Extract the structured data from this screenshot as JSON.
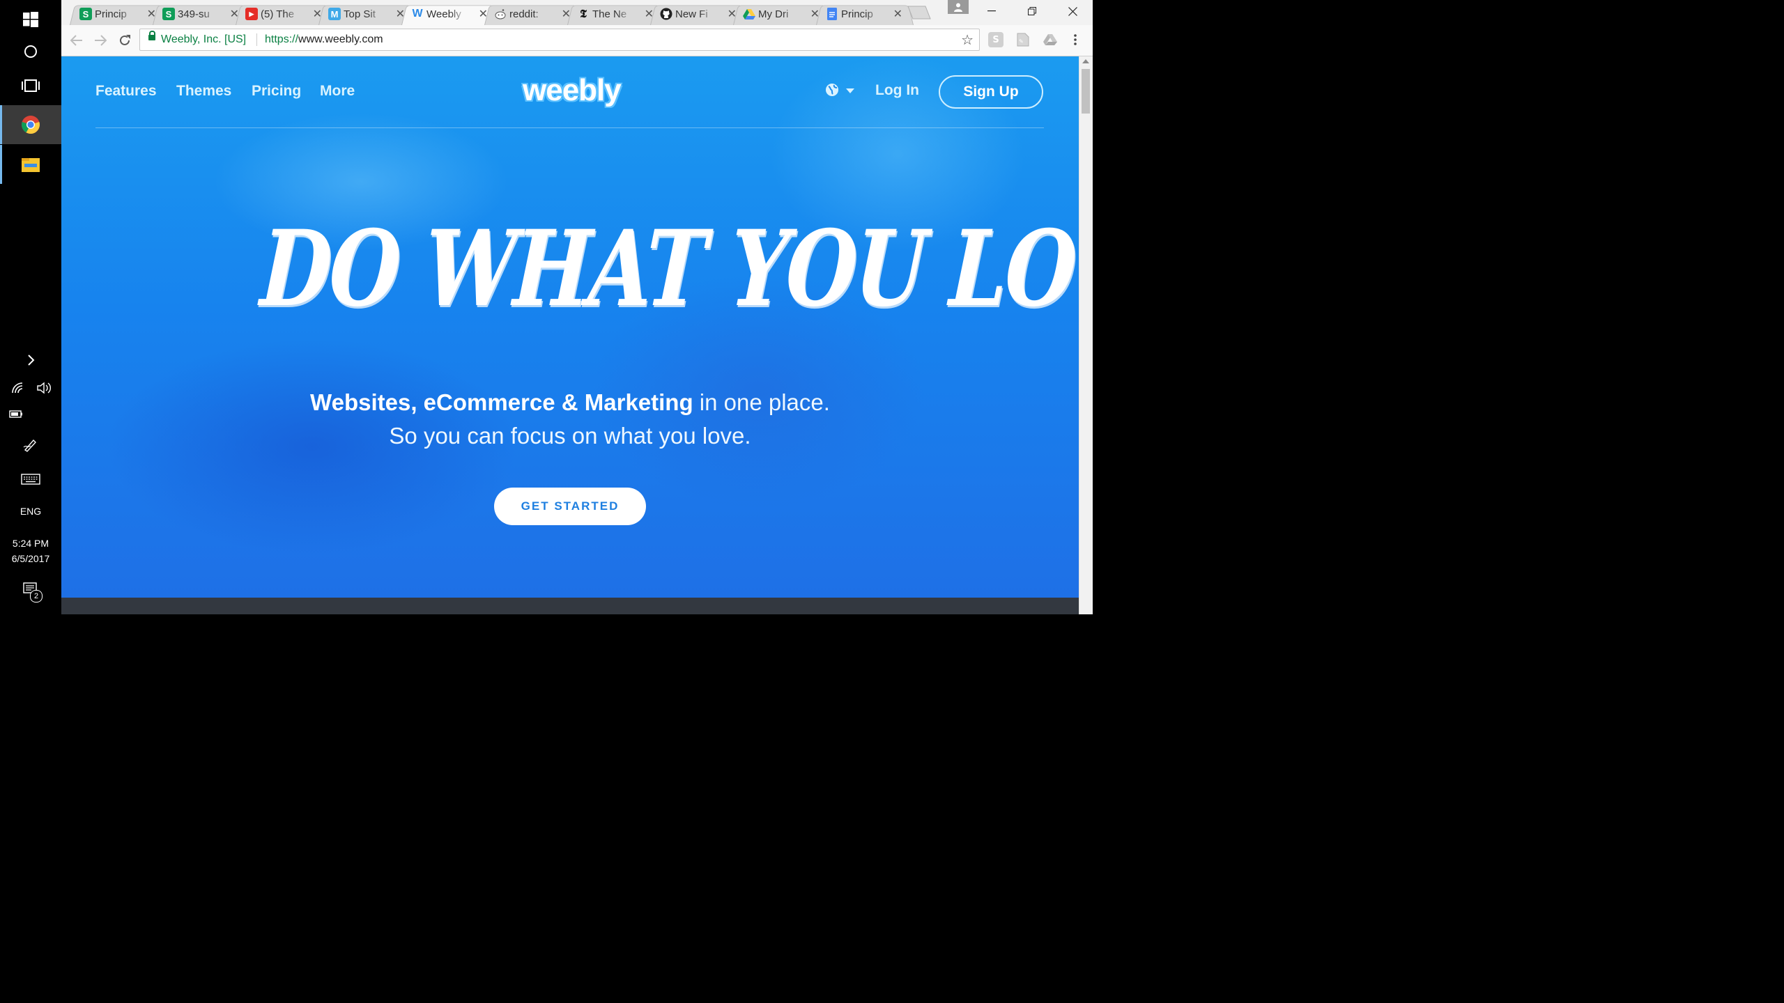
{
  "taskbar": {
    "language": "ENG",
    "time": "5:24 PM",
    "date": "6/5/2017",
    "notification_count": "2"
  },
  "browser": {
    "tabs": [
      {
        "title": "Princip",
        "icon": "sheets-s-icon",
        "active": false
      },
      {
        "title": "349-su",
        "icon": "sheets-s-icon",
        "active": false
      },
      {
        "title": "(5) The",
        "icon": "youtube-icon",
        "active": false
      },
      {
        "title": "Top Sit",
        "icon": "m-icon",
        "active": false
      },
      {
        "title": "Weebly",
        "icon": "weebly-icon",
        "active": true
      },
      {
        "title": "reddit:",
        "icon": "reddit-icon",
        "active": false
      },
      {
        "title": "The Ne",
        "icon": "nytimes-icon",
        "active": false
      },
      {
        "title": "New Fi",
        "icon": "github-icon",
        "active": false
      },
      {
        "title": "My Dri",
        "icon": "google-drive-icon",
        "active": false
      },
      {
        "title": "Princip",
        "icon": "google-docs-icon",
        "active": false
      }
    ],
    "omnibox": {
      "security_label": "Weebly, Inc. [US]",
      "url_scheme": "https://",
      "url_host": "www.weebly.com"
    }
  },
  "site": {
    "nav": {
      "features": "Features",
      "themes": "Themes",
      "pricing": "Pricing",
      "more": "More",
      "logo": "weebly",
      "login": "Log In",
      "signup": "Sign Up"
    },
    "hero": {
      "headline": "DO WHAT YOU LOVE",
      "tagline_bold": "Websites, eCommerce & Marketing",
      "tagline_rest": " in one place.",
      "tagline_line2": "So you can focus on what you love.",
      "cta": "GET STARTED"
    }
  },
  "colors": {
    "hero_blue": "#1783ee",
    "cta_text": "#1e7fe0",
    "secure_green": "#0b8043"
  }
}
